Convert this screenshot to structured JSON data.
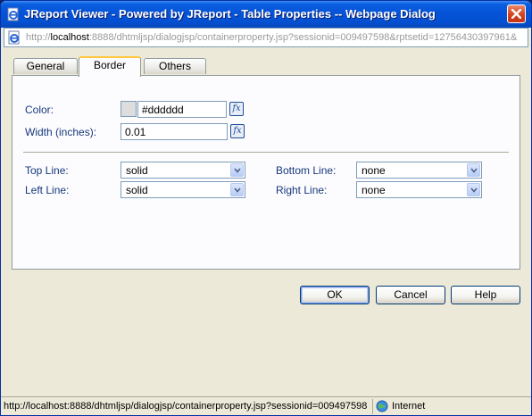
{
  "window": {
    "title": "JReport Viewer - Powered by JReport - Table Properties -- Webpage Dialog",
    "url_prefix": "http://",
    "url_host": "localhost",
    "url_rest": ":8888/dhtmljsp/dialogjsp/containerproperty.jsp?sessionid=009497598&rptsetid=12756430397961&"
  },
  "tabs": [
    {
      "label": "General"
    },
    {
      "label": "Border",
      "active": true
    },
    {
      "label": "Others"
    }
  ],
  "border": {
    "color_label": "Color:",
    "color_value": "#dddddd",
    "swatch_color": "#dddddd",
    "width_label": "Width (inches):",
    "width_value": "0.01",
    "fx_label": "fx",
    "top_line_label": "Top Line:",
    "top_line_value": "solid",
    "left_line_label": "Left Line:",
    "left_line_value": "solid",
    "bottom_line_label": "Bottom Line:",
    "bottom_line_value": "none",
    "right_line_label": "Right Line:",
    "right_line_value": "none"
  },
  "buttons": {
    "ok": "OK",
    "cancel": "Cancel",
    "help": "Help"
  },
  "status": {
    "url": "http://localhost:8888/dhtmljsp/dialogjsp/containerproperty.jsp?sessionid=009497598",
    "zone": "Internet"
  },
  "icons": {
    "title": "ie-page-icon",
    "close": "close-icon",
    "url": "ie-page-icon",
    "fx": "formula-icon",
    "dropdown": "chevron-down-icon",
    "zone": "globe-icon"
  },
  "colors": {
    "title_bar": "#0553d8",
    "label_text": "#16387c",
    "dialog_bg": "#ece9d8",
    "active_tab_accent": "#ffc83c"
  }
}
